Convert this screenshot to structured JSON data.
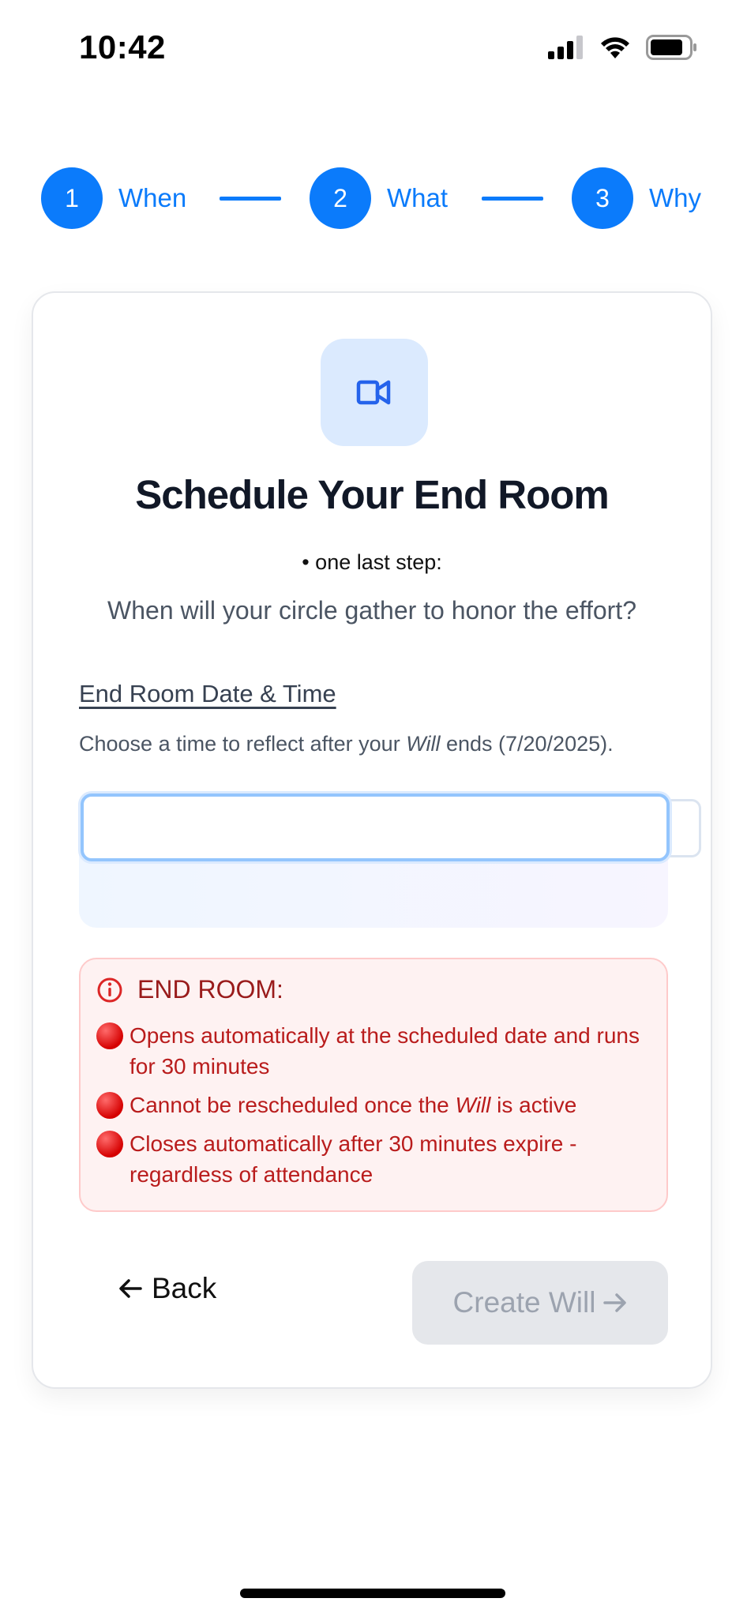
{
  "status_bar": {
    "time": "10:42"
  },
  "stepper": {
    "steps": [
      {
        "number": "1",
        "label": "When"
      },
      {
        "number": "2",
        "label": "What"
      },
      {
        "number": "3",
        "label": "Why"
      }
    ],
    "accent_color": "#0b7bfb"
  },
  "card": {
    "icon": "video-camera-icon",
    "title": "Schedule Your End Room",
    "subtitle": "• one last step:",
    "question": "When will your circle gather to honor the effort?"
  },
  "form": {
    "label": "End Room Date & Time",
    "help_prefix": "Choose a time to reflect after your ",
    "help_emphasis": "Will",
    "help_suffix": " ends (7/20/2025).",
    "input_value": ""
  },
  "warning": {
    "title": "END ROOM:",
    "items": [
      {
        "text": "Opens automatically at the scheduled date and runs for 30 minutes"
      },
      {
        "prefix": "Cannot be rescheduled once the ",
        "emphasis": "Will",
        "suffix": " is active"
      },
      {
        "text": "Closes automatically after 30 minutes expire - regardless of attendance"
      }
    ],
    "color": "#b91c1c"
  },
  "actions": {
    "back_label": "Back",
    "create_label": "Create Will"
  }
}
